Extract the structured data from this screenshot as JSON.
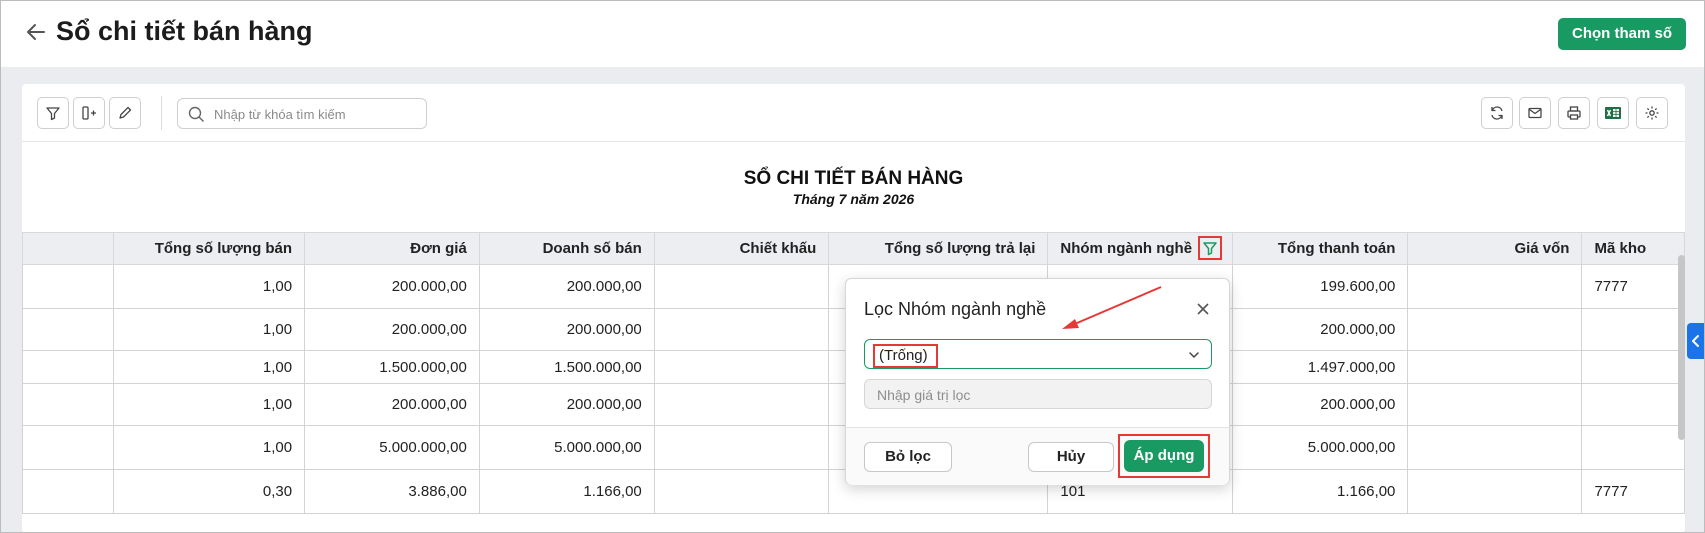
{
  "header": {
    "title": "Sổ chi tiết bán hàng",
    "choose_params": "Chọn tham số"
  },
  "toolbar": {
    "search_placeholder": "Nhập từ khóa tìm kiếm",
    "left_icons": [
      "filter-icon",
      "add-column-icon",
      "edit-icon"
    ],
    "right_icons": [
      "refresh-icon",
      "mail-icon",
      "print-icon",
      "excel-icon",
      "settings-icon"
    ]
  },
  "report": {
    "title": "SỔ CHI TIẾT BÁN HÀNG",
    "subtitle": "Tháng 7 năm 2026"
  },
  "table": {
    "columns": [
      "",
      "Tổng số lượng bán",
      "Đơn giá",
      "Doanh số bán",
      "Chiết khấu",
      "Tổng số lượng trả lại",
      "Nhóm ngành nghề",
      "Tổng thanh toán",
      "Giá vốn",
      "Mã kho"
    ],
    "rows": [
      [
        "",
        "1,00",
        "200.000,00",
        "200.000,00",
        "",
        "",
        "",
        "199.600,00",
        "",
        "7777"
      ],
      [
        "",
        "1,00",
        "200.000,00",
        "200.000,00",
        "",
        "",
        "",
        "200.000,00",
        "",
        ""
      ],
      [
        "",
        "1,00",
        "1.500.000,00",
        "1.500.000,00",
        "",
        "",
        "",
        "1.497.000,00",
        "",
        ""
      ],
      [
        "",
        "1,00",
        "200.000,00",
        "200.000,00",
        "",
        "",
        "",
        "200.000,00",
        "",
        ""
      ],
      [
        "",
        "1,00",
        "5.000.000,00",
        "5.000.000,00",
        "",
        "",
        "",
        "5.000.000,00",
        "",
        ""
      ],
      [
        "",
        "0,30",
        "3.886,00",
        "1.166,00",
        "",
        "",
        "101",
        "1.166,00",
        "",
        "7777"
      ]
    ]
  },
  "filter_popup": {
    "title": "Lọc Nhóm ngành nghề",
    "selected_value": "(Trống)",
    "value_placeholder": "Nhập giá trị lọc",
    "clear_label": "Bỏ lọc",
    "cancel_label": "Hủy",
    "apply_label": "Áp dụng"
  },
  "colors": {
    "primary_green": "#1a9a63",
    "highlight_red": "#e53935",
    "side_tab_blue": "#1a73e8"
  }
}
